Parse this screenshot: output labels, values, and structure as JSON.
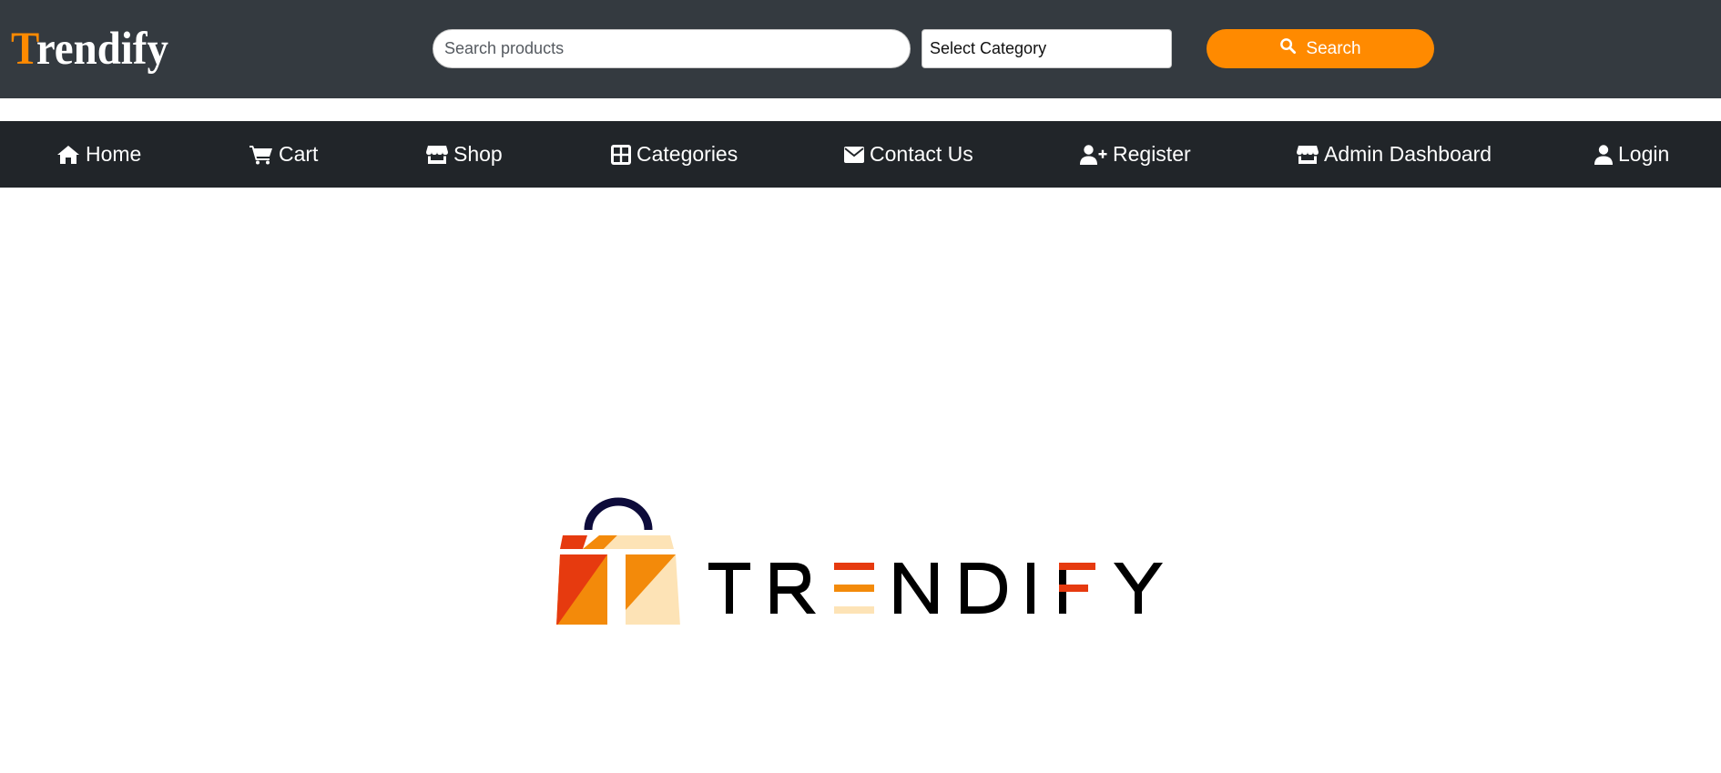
{
  "header": {
    "brand_first": "T",
    "brand_rest": "rendify",
    "search_placeholder": "Search products",
    "category_selected": "Select Category",
    "search_button_label": "Search"
  },
  "nav": {
    "items": [
      {
        "label": "Home",
        "icon": "home-icon"
      },
      {
        "label": "Cart",
        "icon": "cart-icon"
      },
      {
        "label": "Shop",
        "icon": "store-icon"
      },
      {
        "label": "Categories",
        "icon": "grid-icon"
      },
      {
        "label": "Contact Us",
        "icon": "envelope-icon"
      },
      {
        "label": "Register",
        "icon": "user-plus-icon"
      },
      {
        "label": "Admin Dashboard",
        "icon": "store-icon"
      },
      {
        "label": "Login",
        "icon": "user-icon"
      }
    ]
  },
  "hero": {
    "logo_text": "TRENDIFY"
  },
  "colors": {
    "header_bg": "#343a40",
    "nav_bg": "#212529",
    "accent": "#ff8a00",
    "logo_red": "#e63a0f",
    "logo_orange": "#f38a0a",
    "logo_cream": "#fde3b6",
    "logo_navy": "#0d0b3a"
  }
}
